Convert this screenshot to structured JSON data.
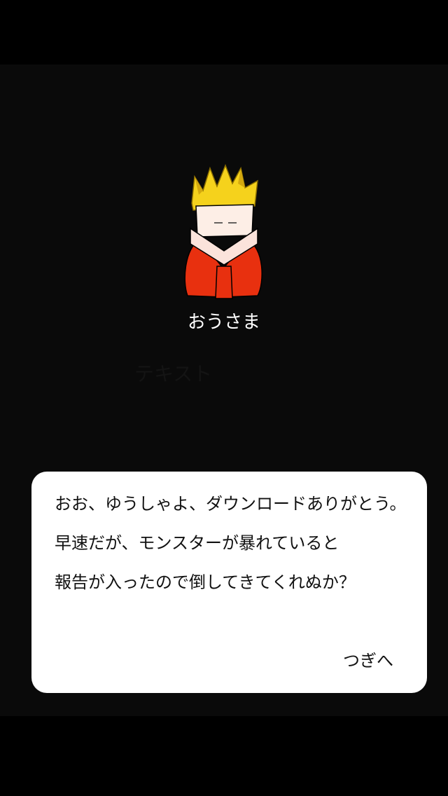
{
  "speaker": {
    "name": "おうさま",
    "portrait_icon": "king-icon"
  },
  "placeholder_text": "テキスト",
  "dialog": {
    "lines": [
      "おお、ゆうしゃよ、ダウンロードありがとう。",
      "早速だが、モンスターが暴れていると",
      "報告が入ったので倒してきてくれぬか？"
    ],
    "next_label": "つぎへ"
  },
  "colors": {
    "background": "#000000",
    "stage": "#0a0a0a",
    "dialog_bg": "#ffffff",
    "crown": "#f5d21c",
    "robe": "#e8300f",
    "text": "#111111"
  }
}
